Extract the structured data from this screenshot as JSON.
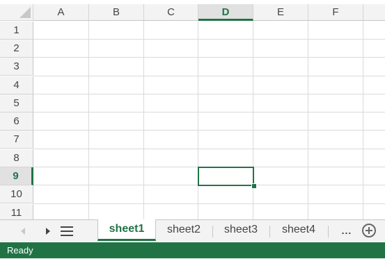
{
  "columns": [
    "A",
    "B",
    "C",
    "D",
    "E",
    "F"
  ],
  "rows": [
    "1",
    "2",
    "3",
    "4",
    "5",
    "6",
    "7",
    "8",
    "9",
    "10",
    "11"
  ],
  "active_cell": {
    "column": "D",
    "row": "9"
  },
  "sheet_tabs": [
    "sheet1",
    "sheet2",
    "sheet3",
    "sheet4"
  ],
  "active_sheet": "sheet1",
  "more_label": "...",
  "status": {
    "text": "Ready"
  },
  "icons": {
    "prev": "triangle-left-icon",
    "next": "triangle-right-icon",
    "menu": "hamburger-icon",
    "add": "plus-circle-icon"
  },
  "colors": {
    "accent": "#217346",
    "header_bg": "#f3f3f3"
  }
}
